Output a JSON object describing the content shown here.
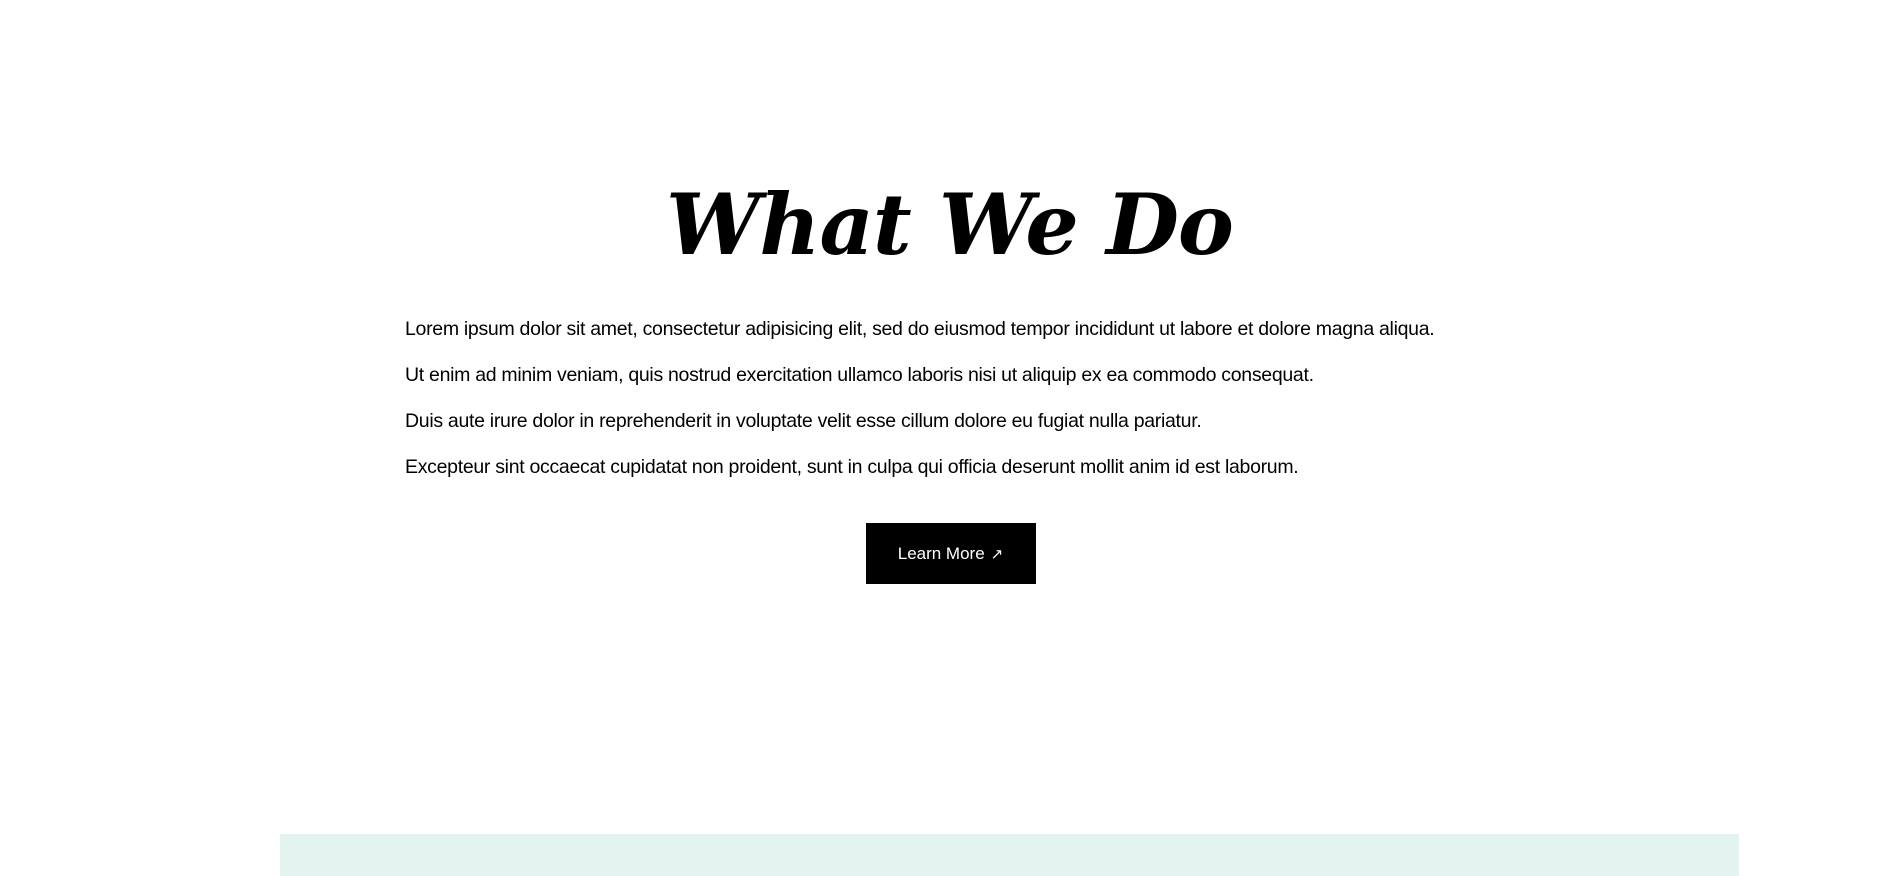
{
  "section": {
    "title": "What We Do",
    "paragraphs": [
      "Lorem ipsum dolor sit amet, consectetur adipisicing elit, sed do eiusmod tempor incididunt ut labore et dolore magna aliqua.",
      "Ut enim ad minim veniam, quis nostrud exercitation ullamco laboris nisi ut aliquip ex ea commodo consequat.",
      "Duis aute irure dolor in reprehenderit in voluptate velit esse cillum dolore eu fugiat nulla pariatur.",
      "Excepteur sint occaecat cupidatat non proident, sunt in culpa qui officia deserunt mollit anim id est laborum."
    ],
    "button": {
      "label": "Learn More",
      "icon": "↗",
      "icon_name": "arrow-up-right-icon"
    }
  },
  "colors": {
    "background": "#ffffff",
    "text": "#000000",
    "button_bg": "#000000",
    "button_text": "#ffffff",
    "next_section_bg": "#e3f3f0"
  }
}
